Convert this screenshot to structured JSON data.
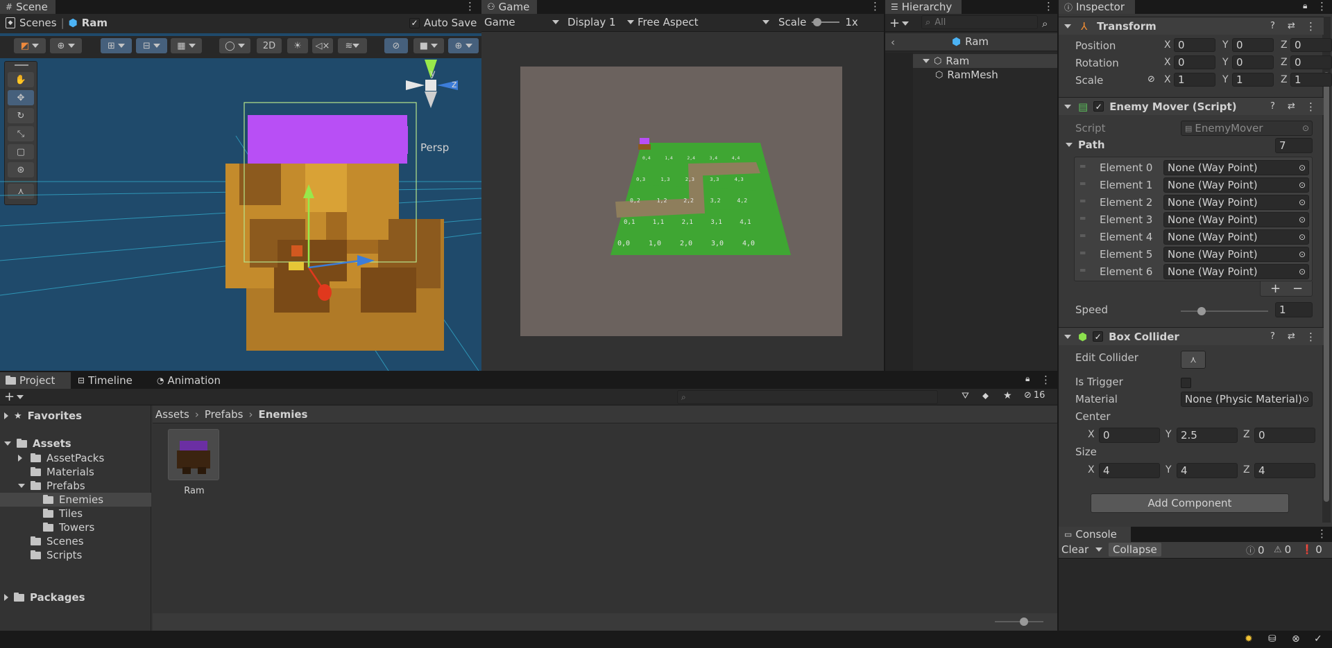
{
  "scene": {
    "tab_label": "Scene",
    "breadcrumb_scenes": "Scenes",
    "breadcrumb_object": "Ram",
    "auto_save_label": "Auto Save",
    "auto_save_checked": true,
    "toggle_2d": "2D",
    "persp_label": "Persp",
    "axis_y": "y",
    "axis_z": "z"
  },
  "game": {
    "tab_label": "Game",
    "mode": "Game",
    "display": "Display 1",
    "aspect": "Free Aspect",
    "scale_label": "Scale",
    "scale_value": "1x",
    "tile_labels": [
      "0,0",
      "1,0",
      "2,0",
      "3,0",
      "4,0",
      "0,1",
      "1,1",
      "2,1",
      "3,1",
      "4,1",
      "0,2",
      "1,2",
      "2,2",
      "3,2",
      "4,2",
      "0,3",
      "1,3",
      "2,3",
      "3,3",
      "4,3",
      "0,4",
      "1,4",
      "2,4",
      "3,4",
      "4,4"
    ]
  },
  "hierarchy": {
    "tab_label": "Hierarchy",
    "search_placeholder": "All",
    "prefab_title": "Ram",
    "items": [
      {
        "label": "Ram",
        "indent": 1
      },
      {
        "label": "RamMesh",
        "indent": 2
      }
    ]
  },
  "inspector": {
    "tab_label": "Inspector",
    "transform": {
      "title": "Transform",
      "position_label": "Position",
      "rotation_label": "Rotation",
      "scale_label": "Scale",
      "position": {
        "x": "0",
        "y": "0",
        "z": "0"
      },
      "rotation": {
        "x": "0",
        "y": "0",
        "z": "0"
      },
      "scale": {
        "x": "1",
        "y": "1",
        "z": "1"
      }
    },
    "enemy_mover": {
      "title": "Enemy Mover (Script)",
      "script_label": "Script",
      "script_value": "EnemyMover",
      "path_label": "Path",
      "path_count": "7",
      "elements": [
        {
          "label": "Element 0",
          "value": "None (Way Point)"
        },
        {
          "label": "Element 1",
          "value": "None (Way Point)"
        },
        {
          "label": "Element 2",
          "value": "None (Way Point)"
        },
        {
          "label": "Element 3",
          "value": "None (Way Point)"
        },
        {
          "label": "Element 4",
          "value": "None (Way Point)"
        },
        {
          "label": "Element 5",
          "value": "None (Way Point)"
        },
        {
          "label": "Element 6",
          "value": "None (Way Point)"
        }
      ],
      "add_label": "+",
      "remove_label": "−",
      "speed_label": "Speed",
      "speed_value": "1"
    },
    "box_collider": {
      "title": "Box Collider",
      "edit_collider_label": "Edit Collider",
      "is_trigger_label": "Is Trigger",
      "material_label": "Material",
      "material_value": "None (Physic Material)",
      "center_label": "Center",
      "center": {
        "x": "0",
        "y": "2.5",
        "z": "0"
      },
      "size_label": "Size",
      "size": {
        "x": "4",
        "y": "4",
        "z": "4"
      }
    },
    "axis": {
      "x": "X",
      "y": "Y",
      "z": "Z"
    },
    "add_component_label": "Add Component"
  },
  "project": {
    "tabs": [
      "Project",
      "Timeline",
      "Animation"
    ],
    "breadcrumb": [
      "Assets",
      "Prefabs",
      "Enemies"
    ],
    "hidden_count": "16",
    "favorites_label": "Favorites",
    "assets_label": "Assets",
    "tree": [
      "AssetPacks",
      "Materials",
      "Prefabs",
      "Enemies",
      "Tiles",
      "Towers",
      "Scenes",
      "Scripts"
    ],
    "packages_label": "Packages",
    "asset_name": "Ram"
  },
  "console": {
    "tab_label": "Console",
    "clear_label": "Clear",
    "collapse_label": "Collapse",
    "info_count": "0",
    "warn_count": "0",
    "error_count": "0"
  },
  "colors": {
    "accent_selection": "#2c5d87",
    "panel_bg": "#282828",
    "toolbar_bg": "#3c3c3c",
    "scene_sky": "#1f4a6b",
    "game_bg": "#6b625e",
    "grass": "#3fa633",
    "path": "#8e7e5c",
    "ram_roof": "#b84ff5",
    "ram_body": "#c48b2c"
  }
}
